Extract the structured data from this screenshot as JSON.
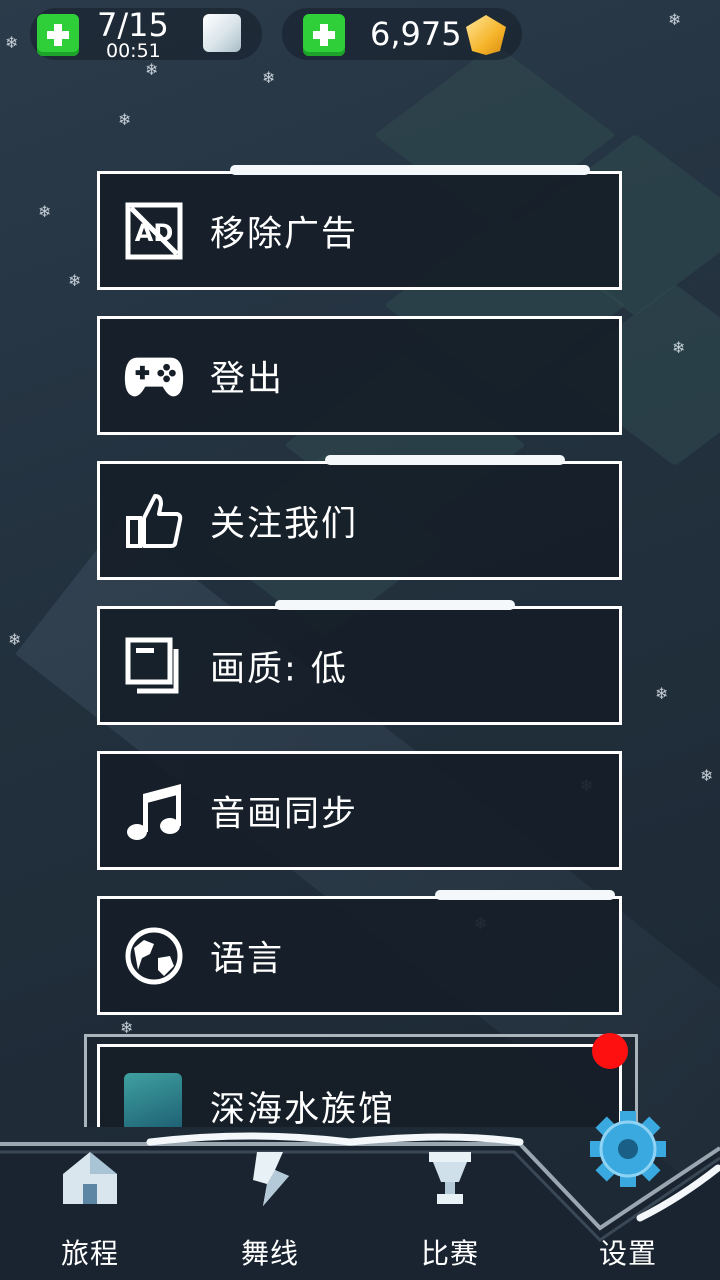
{
  "top_bar": {
    "energy": {
      "count": "7/15",
      "timer": "00:51",
      "add_icon": "plus-icon",
      "icon": "ice-cube-icon"
    },
    "gems": {
      "count": "6,975",
      "add_icon": "plus-icon",
      "icon": "gem-icon"
    }
  },
  "menu": {
    "items": [
      {
        "label": "移除广告",
        "icon": "no-ads-icon"
      },
      {
        "label": "登出",
        "icon": "gamepad-icon"
      },
      {
        "label": "关注我们",
        "icon": "thumbs-up-icon"
      },
      {
        "label": "画质: 低",
        "icon": "quality-icon"
      },
      {
        "label": "音画同步",
        "icon": "music-note-icon"
      },
      {
        "label": "语言",
        "icon": "globe-icon"
      }
    ],
    "aquarium": {
      "label": "深海水族馆",
      "icon": "whale-icon",
      "notification": "red-dot"
    }
  },
  "nav": {
    "tabs": [
      {
        "label": "旅程",
        "icon": "house-icon"
      },
      {
        "label": "舞线",
        "icon": "dance-line-icon"
      },
      {
        "label": "比赛",
        "icon": "trophy-icon"
      },
      {
        "label": "设置",
        "icon": "gear-icon",
        "active": true
      }
    ]
  },
  "colors": {
    "background": "#22303d",
    "button_border": "#ffffff",
    "button_fill": "#161e28",
    "plus_green": "#2fcf3a",
    "notification_red": "#ff1010",
    "gear_blue": "#39a9e0"
  }
}
